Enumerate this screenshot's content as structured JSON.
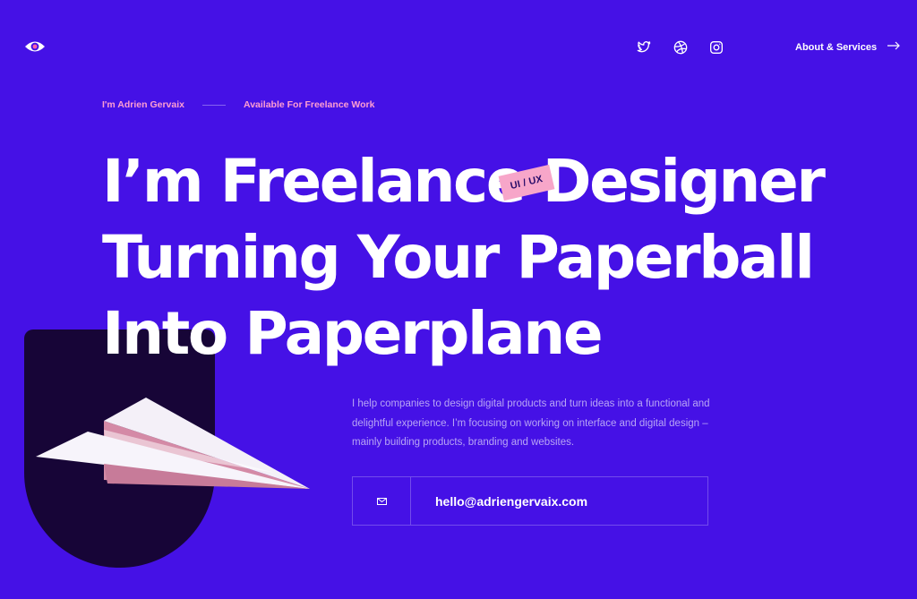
{
  "header": {
    "logo_icon": "eye-logo-icon",
    "social": [
      {
        "name": "twitter",
        "icon": "twitter-icon"
      },
      {
        "name": "dribbble",
        "icon": "dribbble-icon"
      },
      {
        "name": "instagram",
        "icon": "instagram-icon"
      }
    ],
    "about_label": "About & Services",
    "about_icon": "arrow-right-icon"
  },
  "eyebrow": {
    "name": "I'm Adrien Gervaix",
    "status": "Available For Freelance Work"
  },
  "hero": {
    "lines": [
      "I’m Freelance Designer",
      "Turning Your Paperball",
      "Into Paperplane"
    ],
    "tag": "UI / UX"
  },
  "intro": "I help companies to design digital products and turn ideas into a functional and delightful experience. I’m focusing on working on interface and digital design – mainly building products, branding and websites.",
  "contact": {
    "email": "hello@adriengervaix.com",
    "icon": "mail-icon"
  },
  "colors": {
    "background": "#4511e6",
    "accent_pink": "#ff9ed1",
    "tag_pink": "#f7a6c9",
    "dark_shape": "#170537",
    "text_white": "#ffffff",
    "text_muted": "#b8a5f5"
  }
}
